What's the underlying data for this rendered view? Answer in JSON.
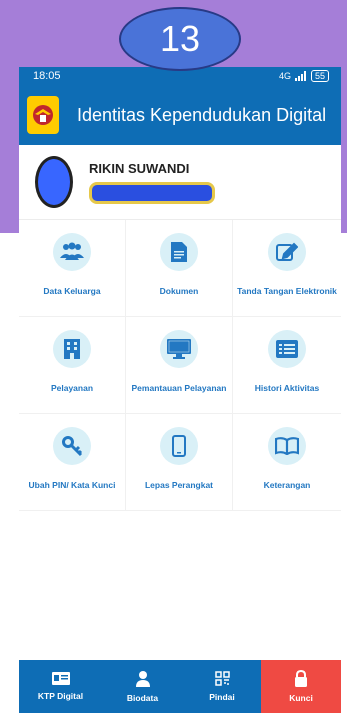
{
  "overlay": {
    "step_number": "13"
  },
  "status_bar": {
    "time": "18:05",
    "signal_text": "4G",
    "battery": "55"
  },
  "app_bar": {
    "title": "Identitas Kependudukan Digital",
    "logo_icon": "garuda-emblem-icon"
  },
  "profile": {
    "name": "RIKIN SUWANDI"
  },
  "menu": [
    {
      "label": "Data Keluarga",
      "icon": "family-icon"
    },
    {
      "label": "Dokumen",
      "icon": "document-icon"
    },
    {
      "label": "Tanda Tangan Elektronik",
      "icon": "signature-icon"
    },
    {
      "label": "Pelayanan",
      "icon": "building-icon"
    },
    {
      "label": "Pemantauan Pelayanan",
      "icon": "monitor-icon"
    },
    {
      "label": "Histori Aktivitas",
      "icon": "history-icon"
    },
    {
      "label": "Ubah PIN/ Kata Kunci",
      "icon": "key-icon"
    },
    {
      "label": "Lepas Perangkat",
      "icon": "phone-icon"
    },
    {
      "label": "Keterangan",
      "icon": "book-icon"
    }
  ],
  "bottom_nav": [
    {
      "label": "KTP Digital",
      "icon": "id-card-icon"
    },
    {
      "label": "Biodata",
      "icon": "person-icon"
    },
    {
      "label": "Pindai",
      "icon": "qr-code-icon"
    },
    {
      "label": "Kunci",
      "icon": "lock-icon",
      "active": true
    }
  ],
  "colors": {
    "primary": "#0e6db5",
    "accent": "#2378c2",
    "icon_bg": "#d9f0f7",
    "active_nav": "#ef4a43",
    "background_overlay": "#a57ed8"
  }
}
